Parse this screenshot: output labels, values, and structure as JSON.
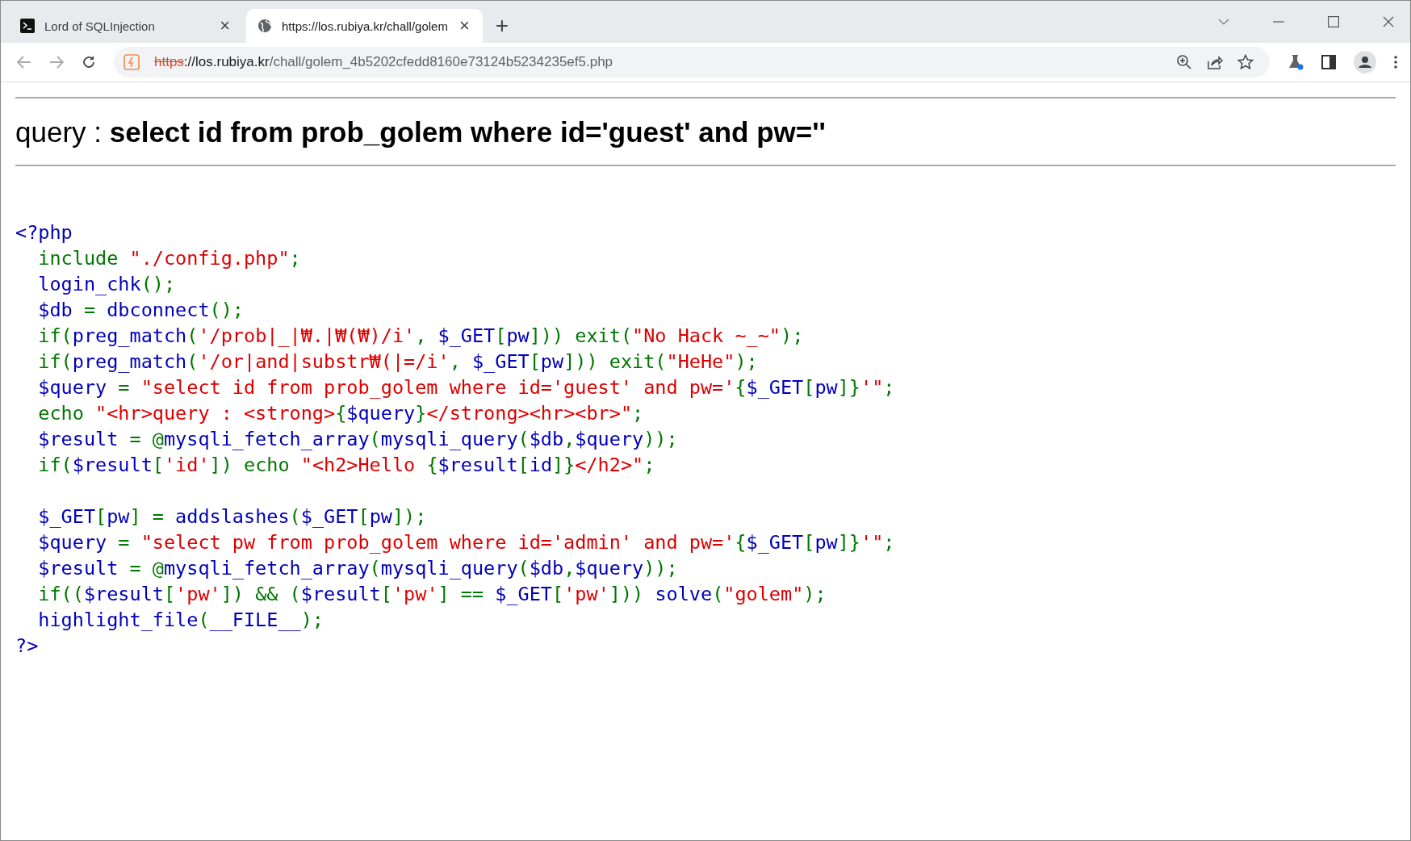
{
  "tabs": [
    {
      "title": "Lord of SQLInjection",
      "selected": false,
      "close": "×"
    },
    {
      "title": "https://los.rubiya.kr/chall/golem",
      "selected": true,
      "close": "×"
    }
  ],
  "new_tab": "+",
  "address_bar": {
    "scheme": "https",
    "host": "://los.rubiya.kr",
    "path": "/chall/golem_4b5202cfedd8160e73124b5234235ef5.php"
  },
  "page": {
    "query_heading": "query : **select id from prob_golem where id='guest' and pw=''**",
    "code_lines": [
      [
        {
          "kind": "d",
          "text": "<?php"
        }
      ],
      [
        {
          "kind": "k",
          "text": "  include "
        },
        {
          "kind": "s",
          "text": "\"./config.php\""
        },
        {
          "kind": "k",
          "text": ";"
        }
      ],
      [
        {
          "kind": "d",
          "text": "  login_chk"
        },
        {
          "kind": "k",
          "text": "();"
        }
      ],
      [
        {
          "kind": "d",
          "text": "  $db"
        },
        {
          "kind": "k",
          "text": " = "
        },
        {
          "kind": "d",
          "text": "dbconnect"
        },
        {
          "kind": "k",
          "text": "();"
        }
      ],
      [
        {
          "kind": "k",
          "text": "  if("
        },
        {
          "kind": "d",
          "text": "preg_match"
        },
        {
          "kind": "k",
          "text": "("
        },
        {
          "kind": "s",
          "text": "'/prob|_|₩.|₩(₩)/i'"
        },
        {
          "kind": "k",
          "text": ", "
        },
        {
          "kind": "d",
          "text": "$_GET"
        },
        {
          "kind": "k",
          "text": "["
        },
        {
          "kind": "d",
          "text": "pw"
        },
        {
          "kind": "k",
          "text": "])) exit("
        },
        {
          "kind": "s",
          "text": "\"No Hack ~_~\""
        },
        {
          "kind": "k",
          "text": ");"
        }
      ],
      [
        {
          "kind": "k",
          "text": "  if("
        },
        {
          "kind": "d",
          "text": "preg_match"
        },
        {
          "kind": "k",
          "text": "("
        },
        {
          "kind": "s",
          "text": "'/or|and|substr₩(|=/i'"
        },
        {
          "kind": "k",
          "text": ", "
        },
        {
          "kind": "d",
          "text": "$_GET"
        },
        {
          "kind": "k",
          "text": "["
        },
        {
          "kind": "d",
          "text": "pw"
        },
        {
          "kind": "k",
          "text": "])) exit("
        },
        {
          "kind": "s",
          "text": "\"HeHe\""
        },
        {
          "kind": "k",
          "text": ");"
        }
      ],
      [
        {
          "kind": "d",
          "text": "  $query"
        },
        {
          "kind": "k",
          "text": " = "
        },
        {
          "kind": "s",
          "text": "\"select id from prob_golem where id='guest' and pw='"
        },
        {
          "kind": "k",
          "text": "{"
        },
        {
          "kind": "d",
          "text": "$_GET"
        },
        {
          "kind": "k",
          "text": "["
        },
        {
          "kind": "d",
          "text": "pw"
        },
        {
          "kind": "k",
          "text": "]}"
        },
        {
          "kind": "s",
          "text": "'\""
        },
        {
          "kind": "k",
          "text": ";"
        }
      ],
      [
        {
          "kind": "k",
          "text": "  echo "
        },
        {
          "kind": "s",
          "text": "\"<hr>query : <strong>"
        },
        {
          "kind": "k",
          "text": "{"
        },
        {
          "kind": "d",
          "text": "$query"
        },
        {
          "kind": "k",
          "text": "}"
        },
        {
          "kind": "s",
          "text": "</strong><hr><br>\""
        },
        {
          "kind": "k",
          "text": ";"
        }
      ],
      [
        {
          "kind": "d",
          "text": "  $result"
        },
        {
          "kind": "k",
          "text": " = @"
        },
        {
          "kind": "d",
          "text": "mysqli_fetch_array"
        },
        {
          "kind": "k",
          "text": "("
        },
        {
          "kind": "d",
          "text": "mysqli_query"
        },
        {
          "kind": "k",
          "text": "("
        },
        {
          "kind": "d",
          "text": "$db"
        },
        {
          "kind": "k",
          "text": ","
        },
        {
          "kind": "d",
          "text": "$query"
        },
        {
          "kind": "k",
          "text": "));"
        }
      ],
      [
        {
          "kind": "k",
          "text": "  if("
        },
        {
          "kind": "d",
          "text": "$result"
        },
        {
          "kind": "k",
          "text": "["
        },
        {
          "kind": "s",
          "text": "'id'"
        },
        {
          "kind": "k",
          "text": "]) echo "
        },
        {
          "kind": "s",
          "text": "\"<h2>Hello "
        },
        {
          "kind": "k",
          "text": "{"
        },
        {
          "kind": "d",
          "text": "$result"
        },
        {
          "kind": "k",
          "text": "["
        },
        {
          "kind": "d",
          "text": "id"
        },
        {
          "kind": "k",
          "text": "]}"
        },
        {
          "kind": "s",
          "text": "</h2>\""
        },
        {
          "kind": "k",
          "text": ";"
        }
      ],
      {
        "kind": "blank"
      },
      [
        {
          "kind": "d",
          "text": "  $_GET"
        },
        {
          "kind": "k",
          "text": "["
        },
        {
          "kind": "d",
          "text": "pw"
        },
        {
          "kind": "k",
          "text": "] = "
        },
        {
          "kind": "d",
          "text": "addslashes"
        },
        {
          "kind": "k",
          "text": "("
        },
        {
          "kind": "d",
          "text": "$_GET"
        },
        {
          "kind": "k",
          "text": "["
        },
        {
          "kind": "d",
          "text": "pw"
        },
        {
          "kind": "k",
          "text": "]);"
        }
      ],
      [
        {
          "kind": "d",
          "text": "  $query"
        },
        {
          "kind": "k",
          "text": " = "
        },
        {
          "kind": "s",
          "text": "\"select pw from prob_golem where id='admin' and pw='"
        },
        {
          "kind": "k",
          "text": "{"
        },
        {
          "kind": "d",
          "text": "$_GET"
        },
        {
          "kind": "k",
          "text": "["
        },
        {
          "kind": "d",
          "text": "pw"
        },
        {
          "kind": "k",
          "text": "]}"
        },
        {
          "kind": "s",
          "text": "'\""
        },
        {
          "kind": "k",
          "text": ";"
        }
      ],
      [
        {
          "kind": "d",
          "text": "  $result"
        },
        {
          "kind": "k",
          "text": " = @"
        },
        {
          "kind": "d",
          "text": "mysqli_fetch_array"
        },
        {
          "kind": "k",
          "text": "("
        },
        {
          "kind": "d",
          "text": "mysqli_query"
        },
        {
          "kind": "k",
          "text": "("
        },
        {
          "kind": "d",
          "text": "$db"
        },
        {
          "kind": "k",
          "text": ","
        },
        {
          "kind": "d",
          "text": "$query"
        },
        {
          "kind": "k",
          "text": "));"
        }
      ],
      [
        {
          "kind": "k",
          "text": "  if(("
        },
        {
          "kind": "d",
          "text": "$result"
        },
        {
          "kind": "k",
          "text": "["
        },
        {
          "kind": "s",
          "text": "'pw'"
        },
        {
          "kind": "k",
          "text": "]) && ("
        },
        {
          "kind": "d",
          "text": "$result"
        },
        {
          "kind": "k",
          "text": "["
        },
        {
          "kind": "s",
          "text": "'pw'"
        },
        {
          "kind": "k",
          "text": "] == "
        },
        {
          "kind": "d",
          "text": "$_GET"
        },
        {
          "kind": "k",
          "text": "["
        },
        {
          "kind": "s",
          "text": "'pw'"
        },
        {
          "kind": "k",
          "text": "])) "
        },
        {
          "kind": "d",
          "text": "solve"
        },
        {
          "kind": "k",
          "text": "("
        },
        {
          "kind": "s",
          "text": "\"golem\""
        },
        {
          "kind": "k",
          "text": ");"
        }
      ],
      [
        {
          "kind": "d",
          "text": "  highlight_file"
        },
        {
          "kind": "k",
          "text": "("
        },
        {
          "kind": "d",
          "text": "__FILE__"
        },
        {
          "kind": "k",
          "text": ");"
        }
      ],
      [
        {
          "kind": "d",
          "text": "?>"
        }
      ]
    ]
  }
}
